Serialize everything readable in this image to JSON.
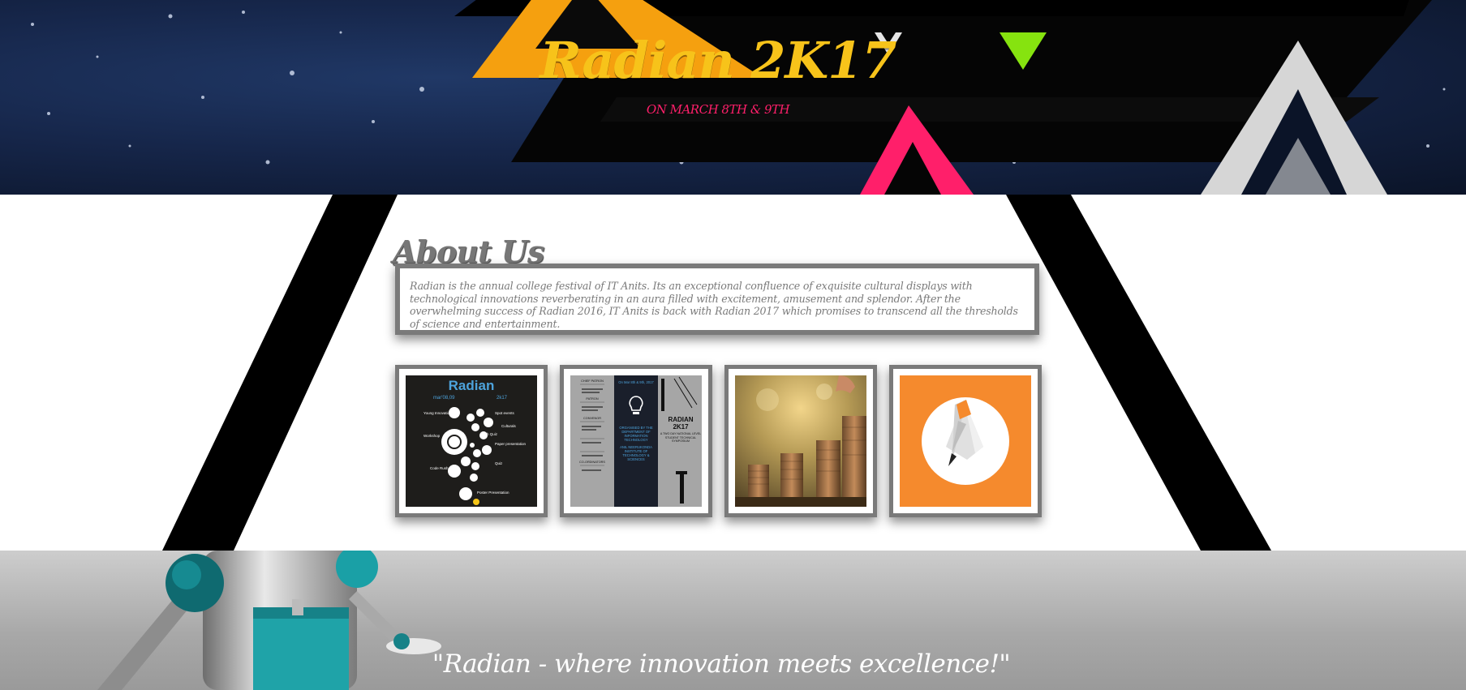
{
  "hero": {
    "title": "Radian 2K17",
    "date": "ON MARCH 8TH & 9TH"
  },
  "about": {
    "heading": "About Us",
    "text": "Radian is the annual college festival of IT Anits. Its an exceptional confluence of exquisite cultural displays with technological innovations reverberating in an aura filled with excitement, amusement and splendor. After the overwhelming success of Radian 2016, IT Anits is back with Radian 2017 which promises to transcend all the thresholds of science and entertainment."
  },
  "gallery": {
    "poster1": {
      "title": "Radian",
      "subtitle": "mar'08,09",
      "year": "2k17",
      "events": [
        "Young Innovation",
        "Spot events",
        "Culturals",
        "Workshop",
        "Tech Quiz",
        "Paper presentation",
        "Code Rush",
        "Quiz",
        "Poster Presentation"
      ]
    },
    "poster2": {
      "left_items": [
        "CHIEF PATRON",
        "PATRON",
        "CONVENOR",
        "CO-ORDINATORS"
      ],
      "date": "On Mar 8th & 9th, 2017",
      "organised": "ORGANISED BY THE DEPARTMENT OF INFORMATION TECHNOLOGY",
      "institute": "ANIL NEERUKONDA INSTITUTE OF TECHNOLOGY & SCIENCES",
      "right_title": "RADIAN 2K17",
      "right_sub": "A TWO DAY NATIONAL LEVEL STUDENT TECHNICAL SYMPOSIUM"
    }
  },
  "footer": {
    "tagline": "\"Radian - where innovation meets excellence!\""
  },
  "colors": {
    "title": "#f7c31a",
    "date": "#ff1f6a",
    "frame": "#7a7a7a",
    "accent_orange": "#f58a2d"
  }
}
